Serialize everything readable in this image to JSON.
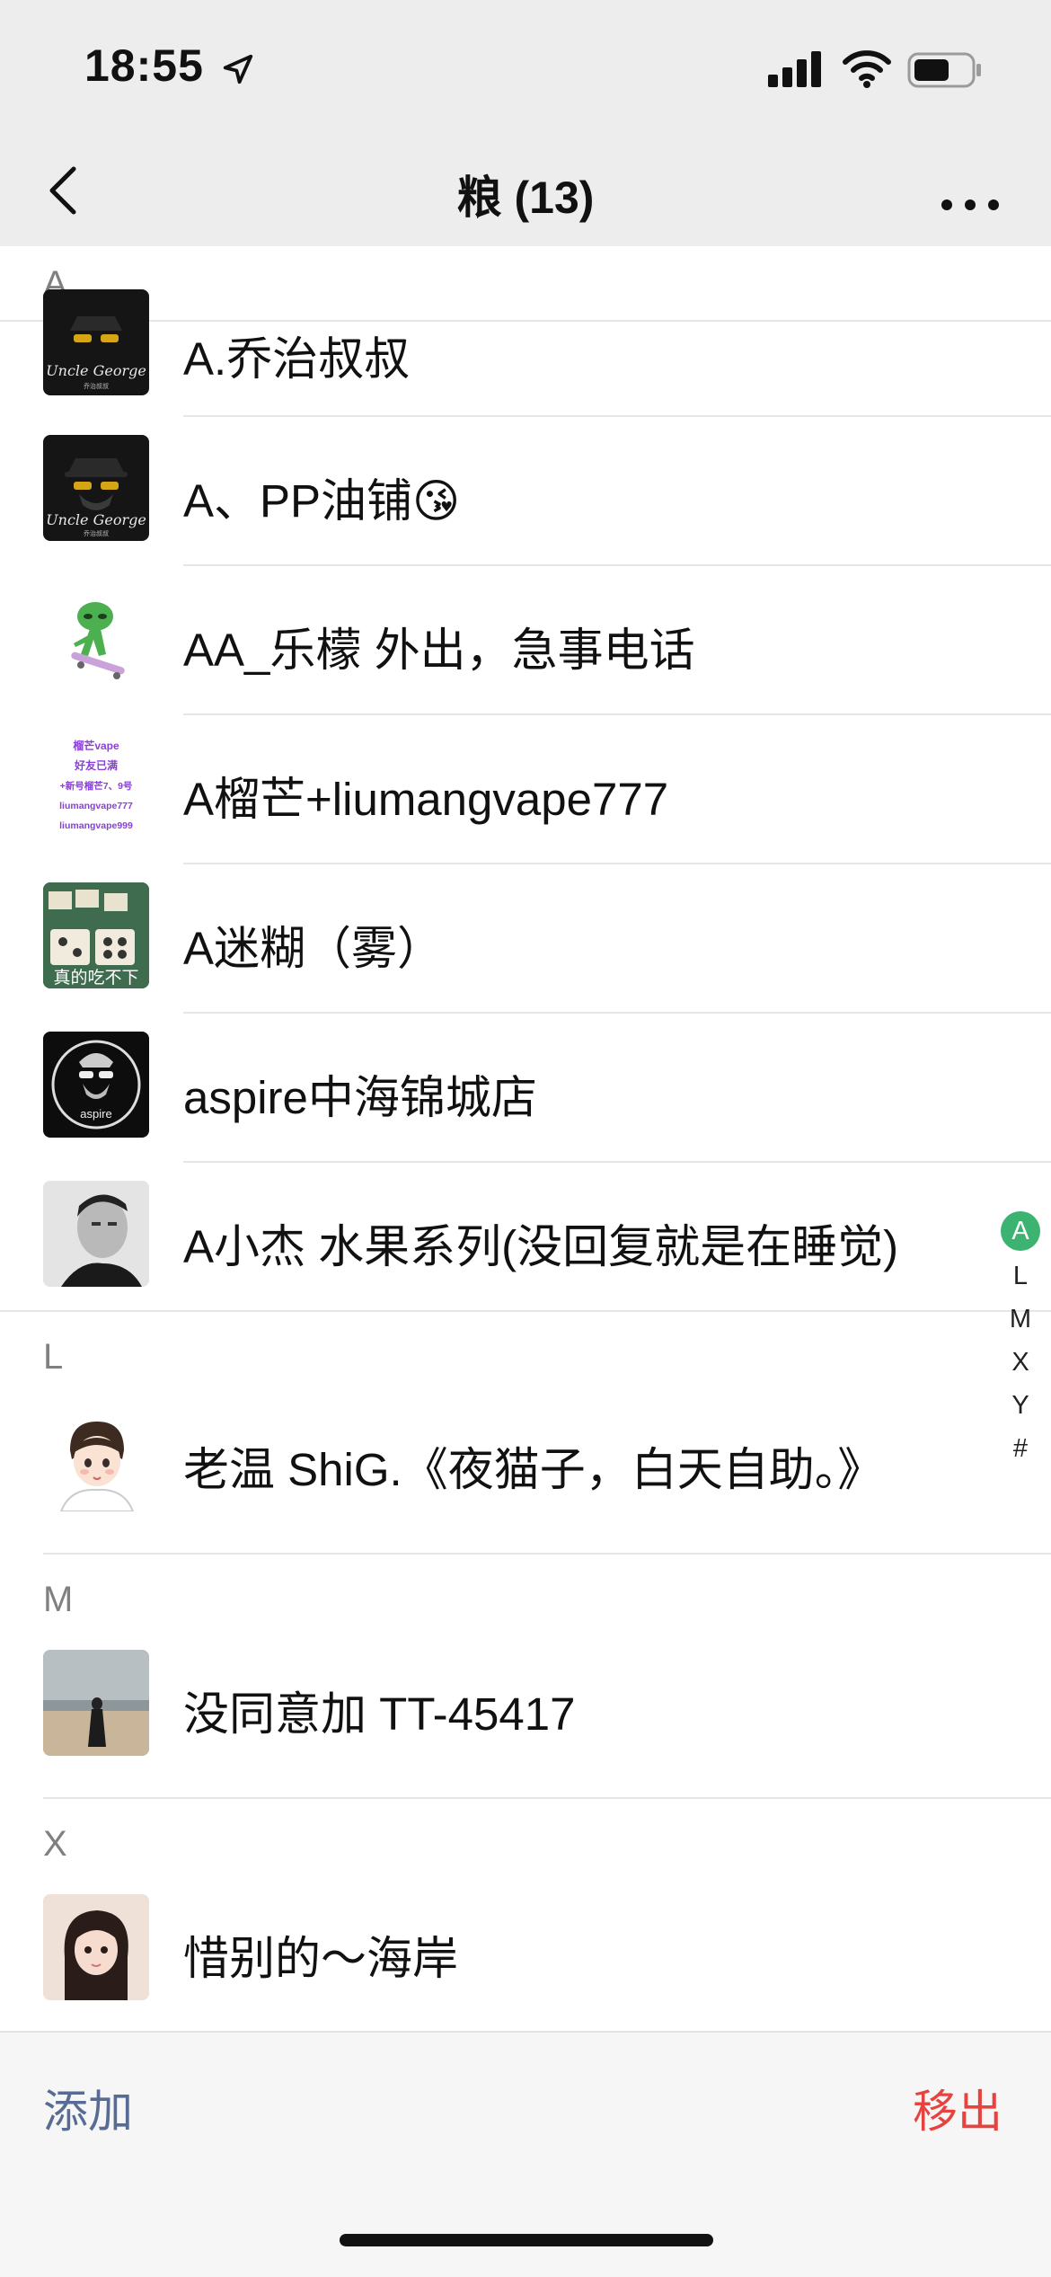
{
  "status_bar": {
    "time": "18:55"
  },
  "navbar": {
    "title": "粮 (13)"
  },
  "sections": [
    {
      "letter": "A",
      "contacts": [
        "A.乔治叔叔",
        "A、PP油铺😘",
        "AA_乐檬  外出，急事电话",
        "A榴芒+liumangvape777",
        "A迷糊（雾）",
        "aspire中海锦城店",
        "A小杰 水果系列(没回复就是在睡觉)"
      ]
    },
    {
      "letter": "L",
      "contacts": [
        "老温 ShiG.《夜猫子，白天自助。》"
      ]
    },
    {
      "letter": "M",
      "contacts": [
        "没同意加 TT-45417"
      ]
    },
    {
      "letter": "X",
      "contacts": [
        "惜别的～海岸"
      ]
    }
  ],
  "avatars": {
    "uncle_george": "Uncle George",
    "uncle_george_sub": "乔治叔叔",
    "liumang_lines": [
      "榴芒vape",
      "好友已满",
      "+新号榴芒7、9号",
      "liumangvape777",
      "liumangvape999"
    ],
    "mahjong_caption": "真的吃不下",
    "aspire_logo": "aspire"
  },
  "index_bar": [
    "A",
    "L",
    "M",
    "X",
    "Y",
    "#"
  ],
  "index_active": "A",
  "bottom_bar": {
    "add": "添加",
    "remove": "移出"
  },
  "colors": {
    "accent_green": "#3cb371",
    "link_blue": "#576b95",
    "danger_red": "#e64340"
  }
}
